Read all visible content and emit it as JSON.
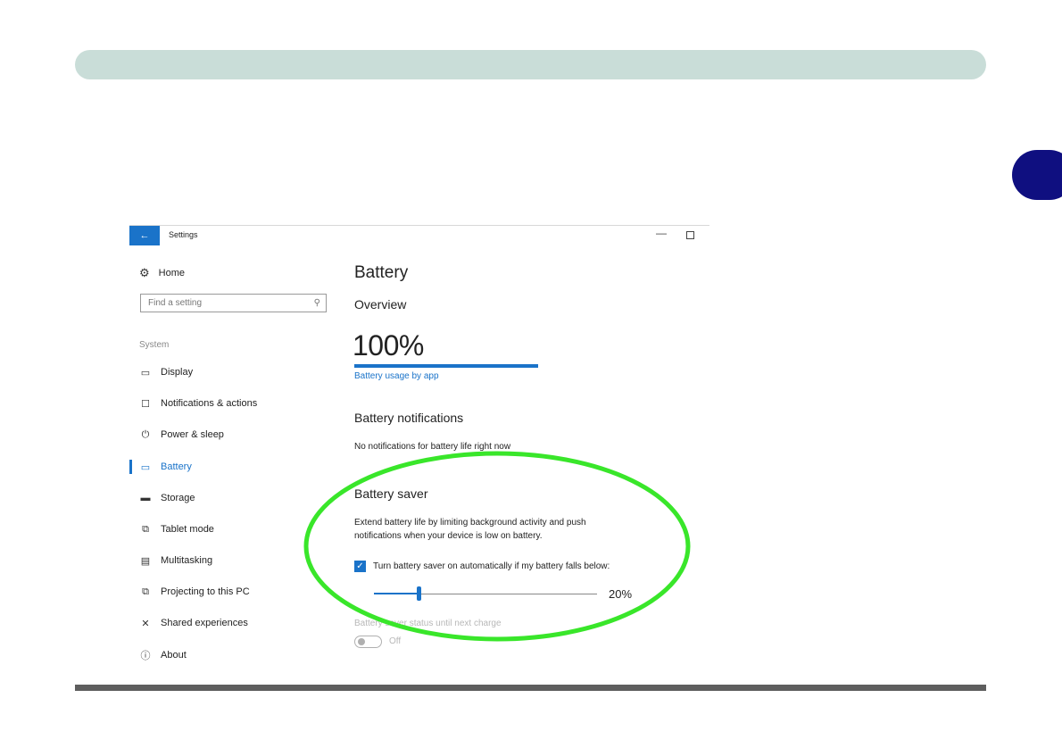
{
  "colors": {
    "accent": "#1a73c9",
    "highlight": "#39e62a",
    "header_bar": "#c9ddd8",
    "side_tab": "#0f0f80"
  },
  "window": {
    "back_icon": "back-arrow-icon",
    "title": "Settings"
  },
  "sidebar": {
    "home_label": "Home",
    "search_placeholder": "Find a setting",
    "section_label": "System",
    "items": [
      {
        "label": "Display",
        "icon": "display-icon"
      },
      {
        "label": "Notifications & actions",
        "icon": "notifications-icon"
      },
      {
        "label": "Power & sleep",
        "icon": "power-icon"
      },
      {
        "label": "Battery",
        "icon": "battery-icon",
        "selected": true
      },
      {
        "label": "Storage",
        "icon": "storage-icon"
      },
      {
        "label": "Tablet mode",
        "icon": "tablet-mode-icon"
      },
      {
        "label": "Multitasking",
        "icon": "multitasking-icon"
      },
      {
        "label": "Projecting to this PC",
        "icon": "projecting-icon"
      },
      {
        "label": "Shared experiences",
        "icon": "shared-experiences-icon"
      },
      {
        "label": "About",
        "icon": "about-icon"
      }
    ]
  },
  "main": {
    "title": "Battery",
    "overview_heading": "Overview",
    "battery_percent": "100%",
    "battery_level": 1.0,
    "usage_link": "Battery usage by app",
    "notifications_heading": "Battery notifications",
    "notifications_text": "No notifications for battery life right now",
    "saver_heading": "Battery saver",
    "saver_desc_line1": "Extend battery life by limiting background activity and push",
    "saver_desc_line2": "notifications when your device is low on battery.",
    "checkbox_label": "Turn battery saver on automatically if my battery falls below:",
    "checkbox_checked": true,
    "slider_value": "20%",
    "slider_fraction": 0.2,
    "status_label": "Battery saver status until next charge",
    "toggle_label": "Off"
  }
}
